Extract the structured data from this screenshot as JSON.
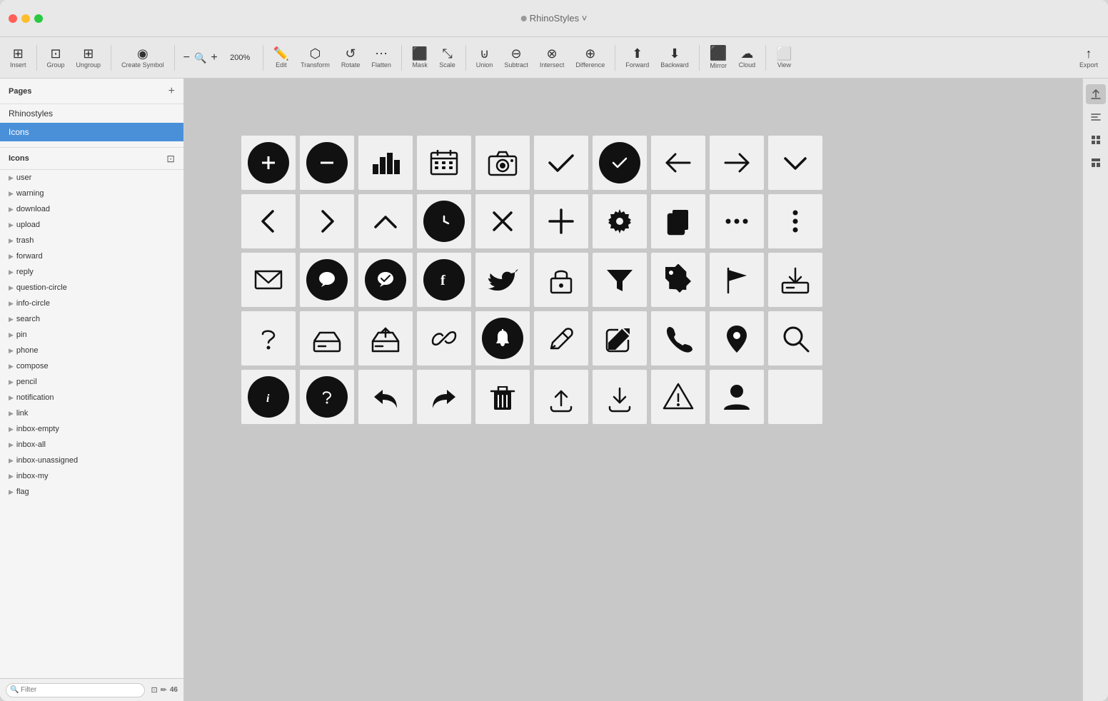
{
  "window": {
    "title": "RhinoStyles",
    "title_suffix": "˅"
  },
  "titlebar": {
    "title": "RhinoStyles ˅"
  },
  "toolbar": {
    "insert_label": "Insert",
    "group_label": "Group",
    "ungroup_label": "Ungroup",
    "create_symbol_label": "Create Symbol",
    "zoom_minus": "−",
    "zoom_value": "200%",
    "zoom_plus": "+",
    "edit_label": "Edit",
    "transform_label": "Transform",
    "rotate_label": "Rotate",
    "flatten_label": "Flatten",
    "mask_label": "Mask",
    "scale_label": "Scale",
    "union_label": "Union",
    "subtract_label": "Subtract",
    "intersect_label": "Intersect",
    "difference_label": "Difference",
    "forward_label": "Forward",
    "backward_label": "Backward",
    "mirror_label": "Mirror",
    "cloud_label": "Cloud",
    "view_label": "View",
    "export_label": "Export"
  },
  "sidebar": {
    "pages_title": "Pages",
    "add_page_label": "+",
    "pages": [
      {
        "name": "Rhinostyles",
        "active": false
      },
      {
        "name": "Icons",
        "active": true
      }
    ],
    "layers_title": "Icons",
    "layer_count": "46",
    "layers": [
      "user",
      "warning",
      "download",
      "upload",
      "trash",
      "forward",
      "reply",
      "question-circle",
      "info-circle",
      "search",
      "pin",
      "phone",
      "compose",
      "pencil",
      "notification",
      "link",
      "inbox-empty",
      "inbox-all",
      "inbox-unassigned",
      "inbox-my",
      "flag"
    ],
    "filter_placeholder": "Filter"
  },
  "icons": {
    "rows": [
      [
        "plus-circle",
        "minus-circle",
        "bar-chart",
        "calendar",
        "camera",
        "checkmark",
        "check-circle",
        "arrow-left",
        "arrow-right",
        "chevron-down"
      ],
      [
        "chevron-left",
        "chevron-right",
        "chevron-up",
        "clock",
        "close",
        "add",
        "gear",
        "copy",
        "ellipsis-h",
        "ellipsis-v"
      ],
      [
        "mail",
        "chat",
        "chat-check",
        "facebook",
        "twitter",
        "lock",
        "filter",
        "tag",
        "flag",
        "inbox-download"
      ],
      [
        "question",
        "inbox-in",
        "inbox-out",
        "link",
        "bell",
        "pencil",
        "compose",
        "phone",
        "location",
        "search"
      ],
      [
        "info",
        "question-circle",
        "reply",
        "forward",
        "trash",
        "upload",
        "download",
        "warning",
        "user",
        ""
      ]
    ]
  },
  "right_panel": {
    "buttons": [
      "upload-icon",
      "align-icon",
      "grid-icon",
      "layout-icon"
    ]
  }
}
